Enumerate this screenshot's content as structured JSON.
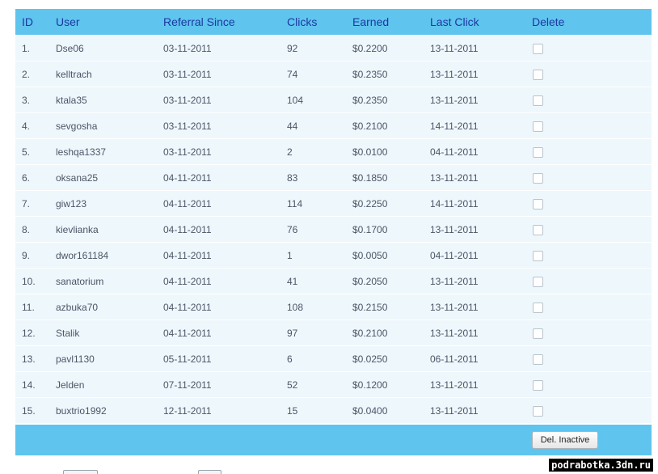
{
  "table": {
    "headers": {
      "id": "ID",
      "user": "User",
      "since": "Referral Since",
      "clicks": "Clicks",
      "earned": "Earned",
      "last": "Last Click",
      "delete": "Delete"
    },
    "rows": [
      {
        "id": "1.",
        "user": "Dse06",
        "since": "03-11-2011",
        "clicks": "92",
        "earned": "$0.2200",
        "last": "13-11-2011"
      },
      {
        "id": "2.",
        "user": "kelltrach",
        "since": "03-11-2011",
        "clicks": "74",
        "earned": "$0.2350",
        "last": "13-11-2011"
      },
      {
        "id": "3.",
        "user": "ktala35",
        "since": "03-11-2011",
        "clicks": "104",
        "earned": "$0.2350",
        "last": "13-11-2011"
      },
      {
        "id": "4.",
        "user": "sevgosha",
        "since": "03-11-2011",
        "clicks": "44",
        "earned": "$0.2100",
        "last": "14-11-2011"
      },
      {
        "id": "5.",
        "user": "leshqa1337",
        "since": "03-11-2011",
        "clicks": "2",
        "earned": "$0.0100",
        "last": "04-11-2011"
      },
      {
        "id": "6.",
        "user": "oksana25",
        "since": "04-11-2011",
        "clicks": "83",
        "earned": "$0.1850",
        "last": "13-11-2011"
      },
      {
        "id": "7.",
        "user": "giw123",
        "since": "04-11-2011",
        "clicks": "114",
        "earned": "$0.2250",
        "last": "14-11-2011"
      },
      {
        "id": "8.",
        "user": "kievlianka",
        "since": "04-11-2011",
        "clicks": "76",
        "earned": "$0.1700",
        "last": "13-11-2011"
      },
      {
        "id": "9.",
        "user": "dwor161184",
        "since": "04-11-2011",
        "clicks": "1",
        "earned": "$0.0050",
        "last": "04-11-2011"
      },
      {
        "id": "10.",
        "user": "sanatorium",
        "since": "04-11-2011",
        "clicks": "41",
        "earned": "$0.2050",
        "last": "13-11-2011"
      },
      {
        "id": "11.",
        "user": "azbuka70",
        "since": "04-11-2011",
        "clicks": "108",
        "earned": "$0.2150",
        "last": "13-11-2011"
      },
      {
        "id": "12.",
        "user": "Stalik",
        "since": "04-11-2011",
        "clicks": "97",
        "earned": "$0.2100",
        "last": "13-11-2011"
      },
      {
        "id": "13.",
        "user": "pavl1130",
        "since": "05-11-2011",
        "clicks": "6",
        "earned": "$0.0250",
        "last": "06-11-2011"
      },
      {
        "id": "14.",
        "user": "Jelden",
        "since": "07-11-2011",
        "clicks": "52",
        "earned": "$0.1200",
        "last": "13-11-2011"
      },
      {
        "id": "15.",
        "user": "buxtrio1992",
        "since": "12-11-2011",
        "clicks": "15",
        "earned": "$0.0400",
        "last": "13-11-2011"
      }
    ]
  },
  "footer": {
    "del_inactive_label": "Del. Inactive"
  },
  "watermark": "podrabotka.3dn.ru",
  "colors": {
    "header_bg": "#5fc4ee",
    "header_text": "#1b3aa0",
    "row_bg": "#eef7fc",
    "cell_text": "#4c5566"
  }
}
